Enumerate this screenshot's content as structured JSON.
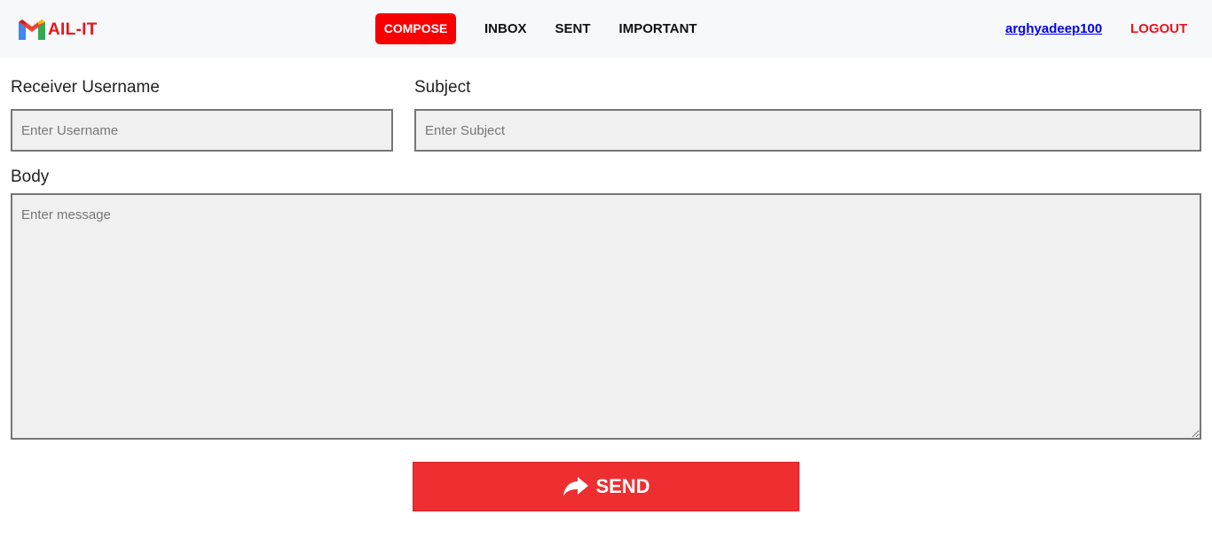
{
  "brand": {
    "name": "AIL-IT"
  },
  "nav": {
    "compose": "COMPOSE",
    "inbox": "INBOX",
    "sent": "SENT",
    "important": "IMPORTANT"
  },
  "user": {
    "username": "arghyadeep100",
    "logout": "LOGOUT"
  },
  "form": {
    "receiver_label": "Receiver Username",
    "receiver_placeholder": "Enter Username",
    "subject_label": "Subject",
    "subject_placeholder": "Enter Subject",
    "body_label": "Body",
    "body_placeholder": "Enter message",
    "send_label": "SEND"
  },
  "colors": {
    "accent": "#f80000",
    "send_button": "#ee2e31",
    "link": "#0000ee",
    "input_bg": "#f0f0f0"
  },
  "icons": {
    "logo": "gmail-m-logo",
    "send": "share-arrow-icon"
  }
}
